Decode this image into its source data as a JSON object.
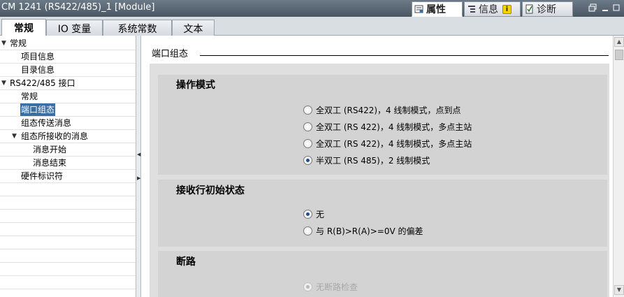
{
  "window": {
    "title": "CM 1241 (RS422/485)_1 [Module]"
  },
  "panel_tabs": [
    {
      "label": "属性",
      "icon": "properties-icon"
    },
    {
      "label": "信息",
      "icon": "info-icon"
    },
    {
      "label": "诊断",
      "icon": "diagnostics-icon"
    }
  ],
  "tabs": [
    {
      "label": "常规"
    },
    {
      "label": "IO 变量"
    },
    {
      "label": "系统常数"
    },
    {
      "label": "文本"
    }
  ],
  "tree": [
    {
      "label": "常规",
      "caret": "▼"
    },
    {
      "label": "项目信息"
    },
    {
      "label": "目录信息"
    },
    {
      "label": "RS422/485 接口",
      "caret": "▼"
    },
    {
      "label": "常规"
    },
    {
      "label": "端口组态",
      "selected": true
    },
    {
      "label": "组态传送消息"
    },
    {
      "label": "组态所接收的消息",
      "caret": "▼"
    },
    {
      "label": "消息开始"
    },
    {
      "label": "消息结束"
    },
    {
      "label": "硬件标识符"
    }
  ],
  "content": {
    "section_header": "端口组态",
    "sections": [
      {
        "title": "操作模式",
        "options": [
          {
            "label": "全双工 (RS422)，4 线制模式，点到点",
            "checked": false
          },
          {
            "label": "全双工 (RS 422)，4 线制模式，多点主站",
            "checked": false
          },
          {
            "label": "全双工 (RS 422)，4 线制模式，多点主站",
            "checked": false
          },
          {
            "label": "半双工 (RS 485)，2 线制模式",
            "checked": true
          }
        ]
      },
      {
        "title": "接收行初始状态",
        "options": [
          {
            "label": "无",
            "checked": true
          },
          {
            "label": "与 R(B)>R(A)>=0V 的偏差",
            "checked": false
          }
        ]
      },
      {
        "title": "断路",
        "options": [
          {
            "label": "无断路检查",
            "checked": true,
            "disabled": true
          }
        ]
      }
    ]
  }
}
